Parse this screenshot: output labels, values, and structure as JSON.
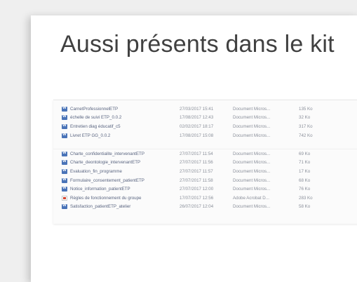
{
  "slide": {
    "title": "Aussi présents dans le kit"
  },
  "explorer": {
    "group1": [
      {
        "name": "CarnetProfessionnelETP",
        "date": "27/03/2017 15:41",
        "type": "Document Micros...",
        "size": "135 Ko",
        "icon": "word-icon"
      },
      {
        "name": "échelle de suivi ETP_0.0.2",
        "date": "17/08/2017 12:43",
        "type": "Document Micros...",
        "size": "32 Ko",
        "icon": "word-icon"
      },
      {
        "name": "Entretien diag éducatif_c5",
        "date": "02/02/2017 18:17",
        "type": "Document Micros...",
        "size": "317 Ko",
        "icon": "word-icon"
      },
      {
        "name": "Livret ETP GG_0.0.2",
        "date": "17/08/2017 15:08",
        "type": "Document Micros...",
        "size": "742 Ko",
        "icon": "word-icon"
      }
    ],
    "group2": [
      {
        "name": "Charte_confidentialite_intervenantETP",
        "date": "27/07/2017 11:54",
        "type": "Document Micros...",
        "size": "69 Ko",
        "icon": "word-icon"
      },
      {
        "name": "Charte_deontologie_intervenantETP",
        "date": "27/07/2017 11:56",
        "type": "Document Micros...",
        "size": "71 Ko",
        "icon": "word-icon"
      },
      {
        "name": "Evaluation_fin_programme",
        "date": "27/07/2017 11:57",
        "type": "Document Micros...",
        "size": "17 Ko",
        "icon": "word-icon"
      },
      {
        "name": "Formulaire_consentement_patientETP",
        "date": "27/07/2017 11:58",
        "type": "Document Micros...",
        "size": "68 Ko",
        "icon": "word-icon"
      },
      {
        "name": "Notice_information_patientETP",
        "date": "27/07/2017 12:00",
        "type": "Document Micros...",
        "size": "76 Ko",
        "icon": "word-icon"
      },
      {
        "name": "Règles de fonctionnement du groupe",
        "date": "17/07/2017 12:56",
        "type": "Adobe Acrobat D...",
        "size": "283 Ko",
        "icon": "pdf-icon"
      },
      {
        "name": "Satisfaction_patientETP_atelier",
        "date": "26/07/2017 12:04",
        "type": "Document Micros...",
        "size": "58 Ko",
        "icon": "word-icon"
      }
    ]
  }
}
